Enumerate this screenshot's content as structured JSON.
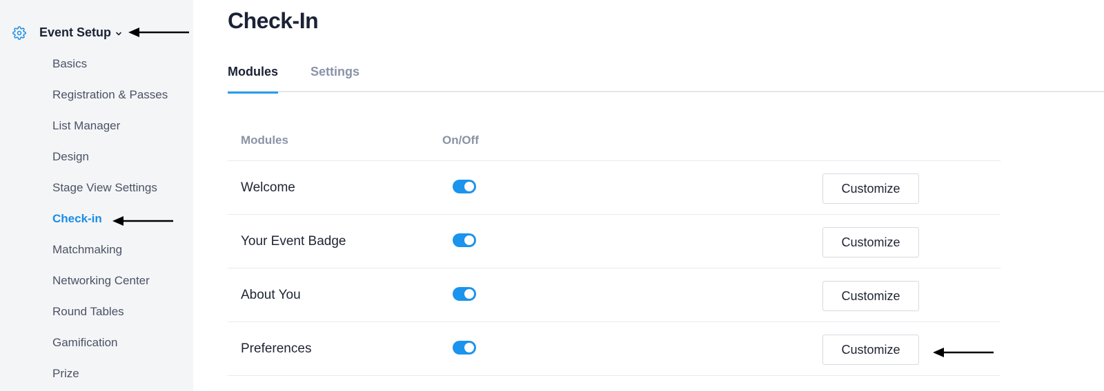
{
  "sidebar": {
    "section_title": "Event Setup",
    "items": [
      {
        "label": "Basics"
      },
      {
        "label": "Registration & Passes"
      },
      {
        "label": "List Manager"
      },
      {
        "label": "Design"
      },
      {
        "label": "Stage View Settings"
      },
      {
        "label": "Check-in",
        "active": true
      },
      {
        "label": "Matchmaking"
      },
      {
        "label": "Networking Center"
      },
      {
        "label": "Round Tables"
      },
      {
        "label": "Gamification"
      },
      {
        "label": "Prize"
      }
    ]
  },
  "main": {
    "title": "Check-In",
    "tabs": [
      {
        "label": "Modules",
        "active": true
      },
      {
        "label": "Settings",
        "active": false
      }
    ],
    "table": {
      "headers": {
        "modules": "Modules",
        "onoff": "On/Off"
      },
      "rows": [
        {
          "name": "Welcome",
          "enabled": true,
          "action": "Customize"
        },
        {
          "name": "Your Event Badge",
          "enabled": true,
          "action": "Customize"
        },
        {
          "name": "About You",
          "enabled": true,
          "action": "Customize"
        },
        {
          "name": "Preferences",
          "enabled": true,
          "action": "Customize"
        }
      ]
    }
  },
  "colors": {
    "accent": "#1a94ec",
    "sidebar_bg": "#f4f5f7",
    "heading": "#1b2235",
    "muted": "#8a93a5"
  }
}
